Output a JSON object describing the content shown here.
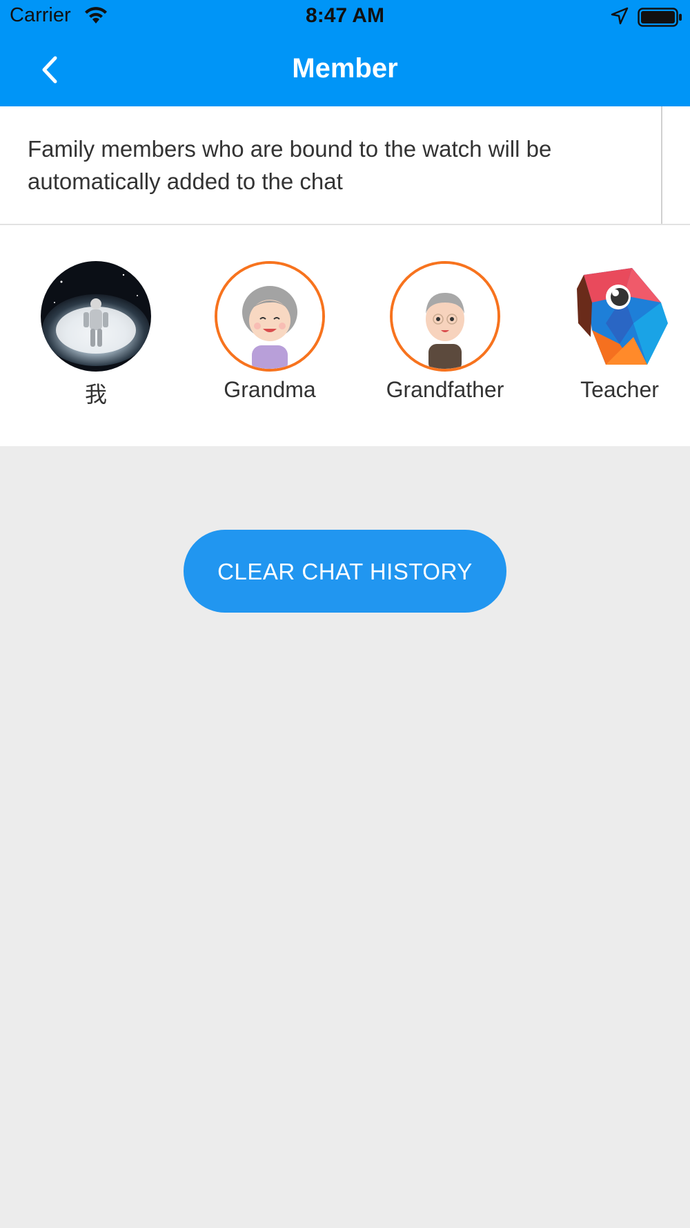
{
  "status_bar": {
    "carrier": "Carrier",
    "time": "8:47 AM",
    "icons": [
      "wifi-icon",
      "location-arrow-icon",
      "battery-icon"
    ]
  },
  "nav": {
    "title": "Member",
    "back_icon": "chevron-left-icon"
  },
  "info": {
    "text": "Family members who are bound to the watch will be automatically added to the chat"
  },
  "members": [
    {
      "name": "我",
      "avatar": "astronaut-avatar"
    },
    {
      "name": "Grandma",
      "avatar": "grandma-avatar"
    },
    {
      "name": "Grandfather",
      "avatar": "grandfather-avatar"
    },
    {
      "name": "Teacher",
      "avatar": "parrot-avatar"
    }
  ],
  "actions": {
    "clear_label": "CLEAR CHAT HISTORY"
  },
  "colors": {
    "header": "#0095F7",
    "button": "#2196F0",
    "ring": "#F7731E",
    "background": "#ECECEC"
  }
}
